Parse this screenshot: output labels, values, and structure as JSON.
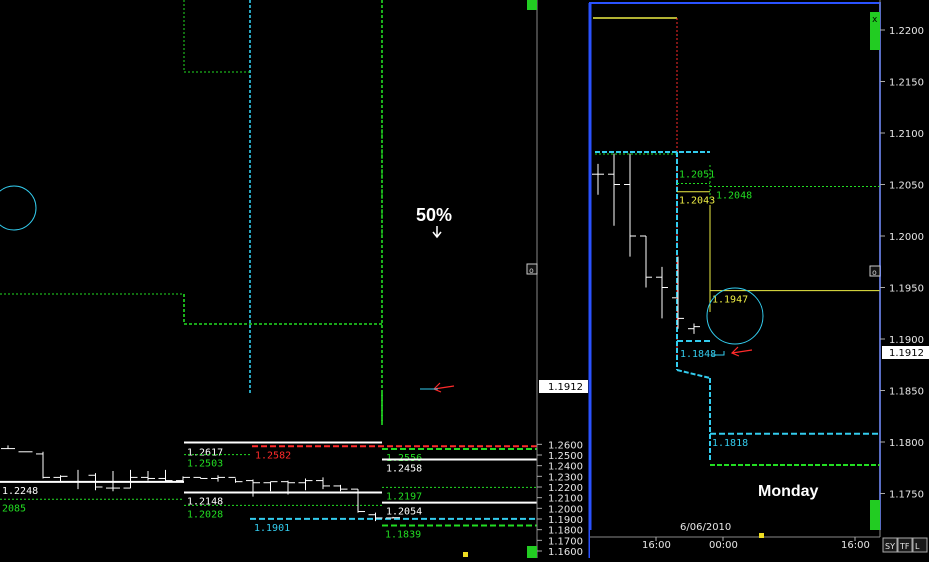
{
  "chart_data": [
    {
      "type": "ohlc",
      "instrument_panel": "left",
      "ylim": [
        1.16,
        1.265
      ],
      "y_ticks": [
        "1.2600",
        "1.2500",
        "1.2400",
        "1.2300",
        "1.2200",
        "1.2100",
        "1.2000",
        "1.1900",
        "1.1800",
        "1.1700",
        "1.1600"
      ],
      "y_tick_values": [
        1.26,
        1.25,
        1.24,
        1.23,
        1.22,
        1.21,
        1.2,
        1.19,
        1.18,
        1.17,
        1.16
      ],
      "price_box": {
        "label": "1.1912",
        "value": 1.1912
      },
      "bars": [
        {
          "o": 1.256,
          "h": 1.259,
          "l": 1.256,
          "c": 1.256
        },
        {
          "o": 1.253,
          "h": 1.253,
          "l": 1.253,
          "c": 1.253
        },
        {
          "o": 1.251,
          "h": 1.253,
          "l": 1.228,
          "c": 1.229
        },
        {
          "o": 1.229,
          "h": 1.231,
          "l": 1.225,
          "c": 1.23
        },
        {
          "o": 1.225,
          "h": 1.236,
          "l": 1.218,
          "c": 1.225
        },
        {
          "o": 1.231,
          "h": 1.233,
          "l": 1.217,
          "c": 1.22
        },
        {
          "o": 1.219,
          "h": 1.235,
          "l": 1.216,
          "c": 1.219
        },
        {
          "o": 1.219,
          "h": 1.236,
          "l": 1.219,
          "c": 1.229
        },
        {
          "o": 1.229,
          "h": 1.235,
          "l": 1.226,
          "c": 1.228
        },
        {
          "o": 1.228,
          "h": 1.236,
          "l": 1.225,
          "c": 1.226
        },
        {
          "o": 1.226,
          "h": 1.23,
          "l": 1.224,
          "c": 1.229
        },
        {
          "o": 1.229,
          "h": 1.229,
          "l": 1.228,
          "c": 1.228
        },
        {
          "o": 1.228,
          "h": 1.231,
          "l": 1.225,
          "c": 1.229
        },
        {
          "o": 1.229,
          "h": 1.228,
          "l": 1.224,
          "c": 1.225
        },
        {
          "o": 1.226,
          "h": 1.227,
          "l": 1.211,
          "c": 1.224
        },
        {
          "o": 1.224,
          "h": 1.225,
          "l": 1.216,
          "c": 1.225
        },
        {
          "o": 1.225,
          "h": 1.226,
          "l": 1.213,
          "c": 1.224
        },
        {
          "o": 1.224,
          "h": 1.228,
          "l": 1.217,
          "c": 1.226
        },
        {
          "o": 1.226,
          "h": 1.229,
          "l": 1.218,
          "c": 1.221
        },
        {
          "o": 1.221,
          "h": 1.222,
          "l": 1.216,
          "c": 1.218
        },
        {
          "o": 1.218,
          "h": 1.218,
          "l": 1.196,
          "c": 1.197
        },
        {
          "o": 1.194,
          "h": 1.196,
          "l": 1.188,
          "c": 1.191
        },
        {
          "o": 1.191,
          "h": 1.192,
          "l": 1.1905,
          "c": 1.1912
        }
      ],
      "levels": [
        {
          "label": "1.2617",
          "value": 1.2617,
          "color": "#ffffff",
          "style": "solid"
        },
        {
          "label": "1.2582",
          "value": 1.2582,
          "color": "#ff2a2a",
          "style": "dashed"
        },
        {
          "label": "1.2556",
          "value": 1.2556,
          "color": "#22dd22",
          "style": "dashed"
        },
        {
          "label": "1.2503",
          "value": 1.2503,
          "color": "#22dd22",
          "style": "dotted"
        },
        {
          "label": "1.2458",
          "value": 1.2458,
          "color": "#ffffff",
          "style": "solid"
        },
        {
          "label": "1.2248",
          "value": 1.2248,
          "color": "#ffffff",
          "style": "solid"
        },
        {
          "label": "1.2197",
          "value": 1.2197,
          "color": "#22dd22",
          "style": "dotted"
        },
        {
          "label": "1.2148",
          "value": 1.2148,
          "color": "#ffffff",
          "style": "solid"
        },
        {
          "label": "2085",
          "value": 1.2085,
          "color": "#22dd22",
          "style": "dotted"
        },
        {
          "label": "1.2054",
          "value": 1.2054,
          "color": "#ffffff",
          "style": "solid"
        },
        {
          "label": "1.2028",
          "value": 1.2028,
          "color": "#22dd22",
          "style": "dotted"
        },
        {
          "label": "1.1901",
          "value": 1.1901,
          "color": "#33ccee",
          "style": "dashed"
        },
        {
          "label": "1.1839",
          "value": 1.1839,
          "color": "#22dd22",
          "style": "dashed"
        }
      ],
      "annotations": [
        {
          "text": "50%"
        }
      ]
    },
    {
      "type": "ohlc",
      "instrument_panel": "right",
      "ylim": [
        1.175,
        1.225
      ],
      "y_ticks": [
        "1.2200",
        "1.2150",
        "1.2100",
        "1.2050",
        "1.2000",
        "1.1950",
        "1.1900",
        "1.1850",
        "1.1800",
        "1.1750"
      ],
      "y_tick_values": [
        1.22,
        1.215,
        1.21,
        1.205,
        1.2,
        1.195,
        1.19,
        1.185,
        1.18,
        1.175
      ],
      "price_box": {
        "label": "1.1912",
        "value": 1.1912
      },
      "x_ticks": [
        "16:00",
        "00:00",
        "16:00"
      ],
      "date_label": "6/06/2010",
      "bars": [
        {
          "o": 1.206,
          "h": 1.207,
          "l": 1.204,
          "c": 1.206
        },
        {
          "o": 1.206,
          "h": 1.208,
          "l": 1.201,
          "c": 1.205
        },
        {
          "o": 1.205,
          "h": 1.208,
          "l": 1.198,
          "c": 1.2
        },
        {
          "o": 1.2,
          "h": 1.2,
          "l": 1.195,
          "c": 1.196
        },
        {
          "o": 1.196,
          "h": 1.197,
          "l": 1.192,
          "c": 1.195
        },
        {
          "o": 1.194,
          "h": 1.198,
          "l": 1.191,
          "c": 1.192
        },
        {
          "o": 1.191,
          "h": 1.1915,
          "l": 1.1905,
          "c": 1.1912
        }
      ],
      "levels": [
        {
          "label": "1.2051",
          "value": 1.2051,
          "color": "#22dd22",
          "style": "dotted"
        },
        {
          "label": "1.2048",
          "value": 1.2048,
          "color": "#22dd22",
          "style": "dotted"
        },
        {
          "label": "1.2043",
          "value": 1.2043,
          "color": "#eeee44",
          "style": "solid"
        },
        {
          "label": "1.1947",
          "value": 1.1947,
          "color": "#eeee44",
          "style": "solid"
        },
        {
          "label": "1.1848",
          "value": 1.1898,
          "color": "#33ccee",
          "style": "dashed"
        },
        {
          "label": "1.1818",
          "value": 1.1808,
          "color": "#33ccee",
          "style": "dashed"
        }
      ],
      "annotations": [
        {
          "text": "Monday"
        }
      ]
    }
  ],
  "ui": {
    "buttons": [
      "SY",
      "TF",
      "L"
    ],
    "side_icon": "x",
    "colors": {
      "background": "#000000",
      "panel_border": "#2a52ff",
      "green": "#22dd22",
      "cyan": "#33ccee",
      "red": "#ff2a2a",
      "yellow": "#eeee44",
      "white": "#ffffff"
    }
  }
}
